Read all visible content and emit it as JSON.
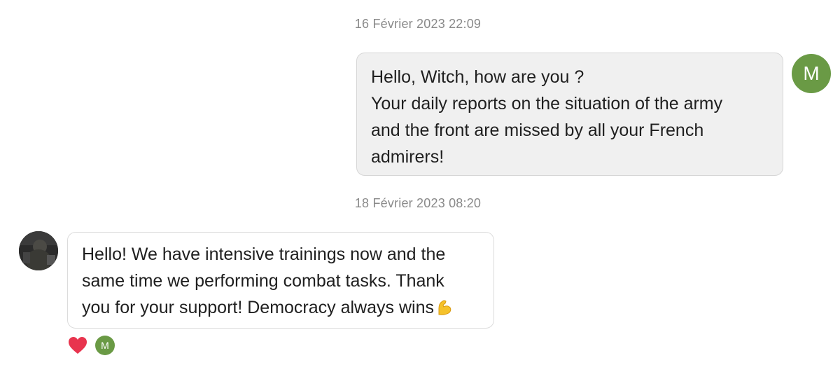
{
  "conversation": {
    "messages": [
      {
        "timestamp": "16 Février 2023 22:09",
        "sender_initial": "M",
        "lines": [
          "Hello, Witch, how are you ?",
          "Your daily reports on the situation of the army",
          "and the front are missed by all your French",
          "admirers!"
        ]
      },
      {
        "timestamp": "18 Février 2023 08:20",
        "lines": [
          "Hello! We have intensive trainings now and the",
          "same time we performing combat tasks. Thank",
          "you for your support! Democracy always wins"
        ],
        "reactions": {
          "emoji": "heart-icon",
          "reactor_initial": "M"
        }
      }
    ]
  },
  "colors": {
    "avatar_green": "#6a9a45",
    "heart_red": "#e8344e",
    "outgoing_bubble_bg": "#f0f0f0",
    "timestamp_gray": "#8a8a8a"
  }
}
